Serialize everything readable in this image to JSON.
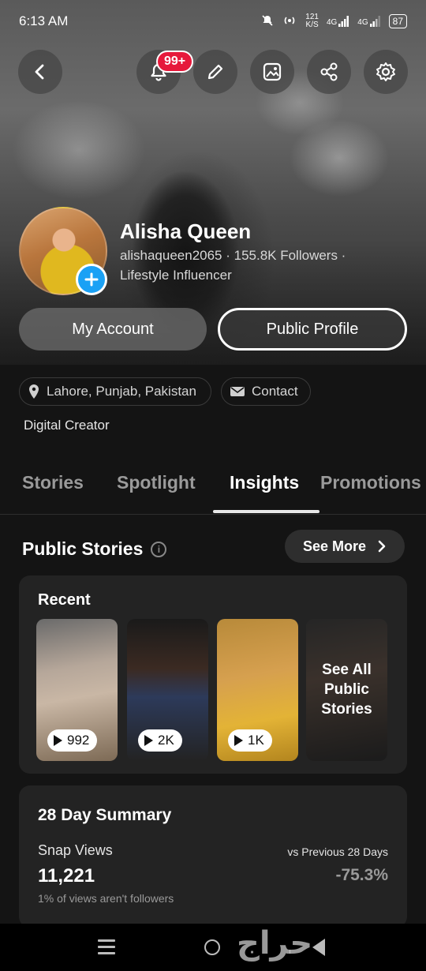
{
  "status_bar": {
    "time": "6:13 AM",
    "speed_top": "121",
    "speed_unit": "K/S",
    "net1": "4G",
    "net2": "4G",
    "battery": "87"
  },
  "header": {
    "notifications_badge": "99+"
  },
  "profile": {
    "name": "Alisha Queen",
    "handle_followers": "alishaqueen2065 · 155.8K Followers ·",
    "category": "Lifestyle Influencer",
    "my_account_label": "My Account",
    "public_profile_label": "Public Profile",
    "location": "Lahore, Punjab, Pakistan",
    "contact_label": "Contact",
    "bio": "Digital Creator"
  },
  "tabs": [
    {
      "label": "Stories"
    },
    {
      "label": "Spotlight"
    },
    {
      "label": "Insights"
    },
    {
      "label": "Promotions"
    }
  ],
  "public_stories": {
    "title": "Public Stories",
    "see_more_label": "See More",
    "recent_title": "Recent",
    "thumbs": [
      {
        "views": "992"
      },
      {
        "views": "2K"
      },
      {
        "views": "1K"
      }
    ],
    "see_all_line1": "See All",
    "see_all_line2": "Public",
    "see_all_line3": "Stories"
  },
  "summary": {
    "title": "28 Day Summary",
    "snap_views_label": "Snap Views",
    "snap_views_value": "11,221",
    "note": "1% of views aren't followers",
    "vs_label": "vs Previous 28 Days",
    "vs_value": "-75.3%"
  },
  "watermark": "حراج"
}
